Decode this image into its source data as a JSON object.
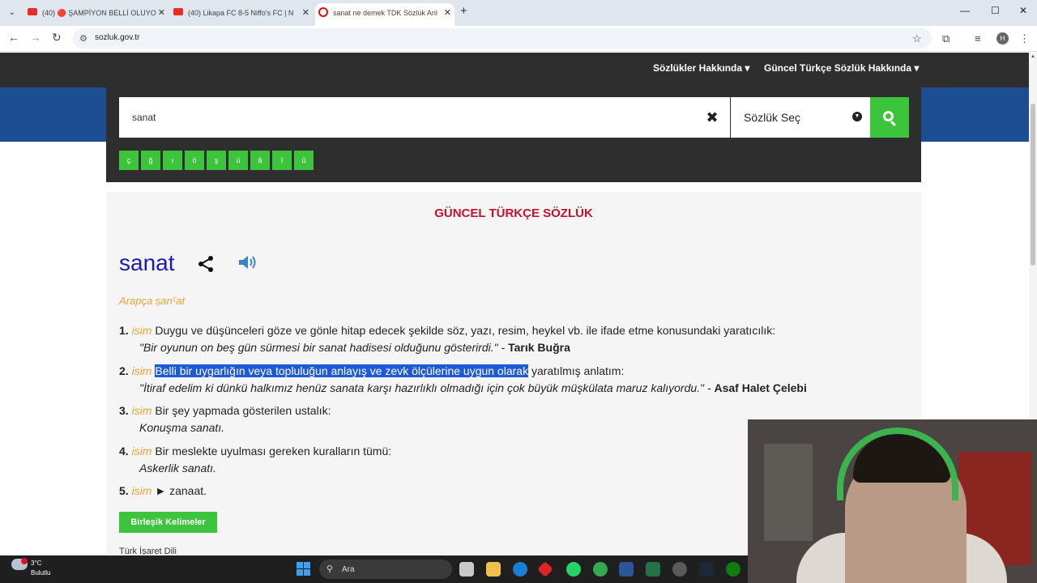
{
  "browser": {
    "tabs": [
      {
        "label": "(40) 🔴 ŞAMPİYON BELLİ OLUYO",
        "active": false
      },
      {
        "label": "(40) Likapa FC 8-5 Niffo's FC | N",
        "active": false
      },
      {
        "label": "sanat ne demek TDK Sözlük Anl",
        "active": true
      }
    ],
    "url": "sozluk.gov.tr",
    "profile_initial": "H",
    "icons": {
      "back": "←",
      "forward": "→",
      "reload": "↻",
      "new_tab": "+",
      "bookmark": "☆",
      "minimize": "—",
      "maximize": "☐",
      "close": "✕"
    }
  },
  "site": {
    "nav": {
      "about_dictionaries": "Sözlükler Hakkında",
      "about_current": "Güncel Türkçe Sözlük Hakkında"
    },
    "search": {
      "value": "sanat",
      "select_label": "Sözlük Seç",
      "special_chars": [
        "ç",
        "ğ",
        "ı",
        "ö",
        "ş",
        "ü",
        "â",
        "î",
        "û"
      ]
    },
    "dictionary_title": "GÜNCEL TÜRKÇE SÖZLÜK",
    "word": "sanat",
    "origin": "Arapça ṣanˁat",
    "meanings": [
      {
        "num": "1.",
        "pos": "isim",
        "text": "Duygu ve düşünceleri göze ve gönle hitap edecek şekilde söz, yazı, resim, heykel vb. ile ifade etme konusundaki yaratıcılık:",
        "example": "\"Bir oyunun on beş gün sürmesi bir sanat hadisesi olduğunu gösterirdi.\" -",
        "author": "Tarık Buğra"
      },
      {
        "num": "2.",
        "pos": "isim",
        "highlight": "Belli bir uygarlığın veya topluluğun anlayış ve zevk ölçülerine uygun olarak",
        "text": "yaratılmış anlatım:",
        "example": "\"İtiraf edelim ki dünkü halkımız henüz sanata karşı hazırlıklı olmadığı için çok büyük müşkülata maruz kalıyordu.\" -",
        "author": "Asaf Halet Çelebi"
      },
      {
        "num": "3.",
        "pos": "isim",
        "text": "Bir şey yapmada gösterilen ustalık:",
        "example": "Konuşma sanatı."
      },
      {
        "num": "4.",
        "pos": "isim",
        "text": "Bir meslekte uyulması gereken kuralların tümü:",
        "example": "Askerlik sanatı."
      },
      {
        "num": "5.",
        "pos": "isim",
        "text": "► zanaat."
      }
    ],
    "compound_button": "Birleşik Kelimeler",
    "sign_language": "Türk İşaret Dili"
  },
  "taskbar": {
    "weather_temp": "3°C",
    "weather_desc": "Bulutlu",
    "search_placeholder": "Ara"
  },
  "colors": {
    "accent_green": "#3cc43c",
    "title_red": "#c8102e",
    "word_blue": "#1a1ab0",
    "pos_orange": "#e8a33a",
    "highlight_blue": "#1e5ad6"
  }
}
